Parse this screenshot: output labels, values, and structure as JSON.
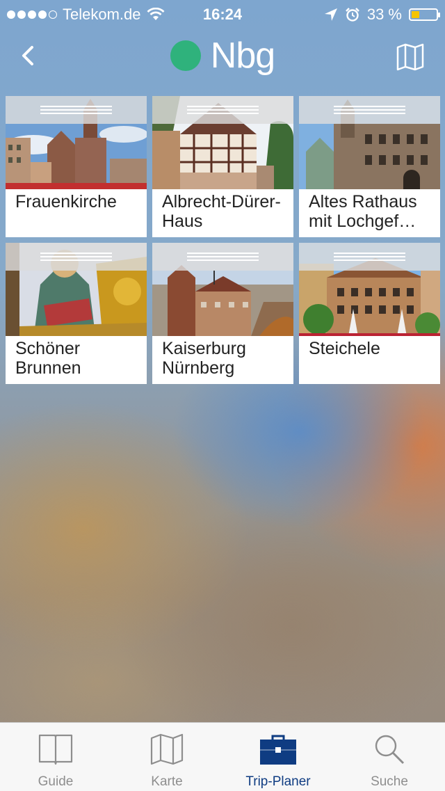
{
  "status_bar": {
    "carrier": "Telekom.de",
    "time": "16:24",
    "battery_percent": "33 %",
    "battery_level": 0.33,
    "signal_dots_filled": 4,
    "signal_dots_total": 5
  },
  "nav": {
    "title": "Nbg",
    "title_dot_color": "#2fb27c",
    "back_icon": "chevron-left-icon",
    "map_icon": "map-icon"
  },
  "tiles": [
    {
      "label": "Frauenkirche"
    },
    {
      "label": "Albrecht-Dürer-Haus"
    },
    {
      "label": "Altes Rathaus mit Lochgef…"
    },
    {
      "label": "Schöner Brunnen"
    },
    {
      "label": "Kaiserburg Nürnberg"
    },
    {
      "label": "Steichele"
    }
  ],
  "tab_bar": {
    "items": [
      {
        "label": "Guide",
        "icon": "book-icon",
        "active": false
      },
      {
        "label": "Karte",
        "icon": "map-icon",
        "active": false
      },
      {
        "label": "Trip-Planer",
        "icon": "briefcase-icon",
        "active": true
      },
      {
        "label": "Suche",
        "icon": "search-icon",
        "active": false
      }
    ],
    "active_color": "#0f3c82",
    "inactive_color": "#8e8e8e"
  }
}
